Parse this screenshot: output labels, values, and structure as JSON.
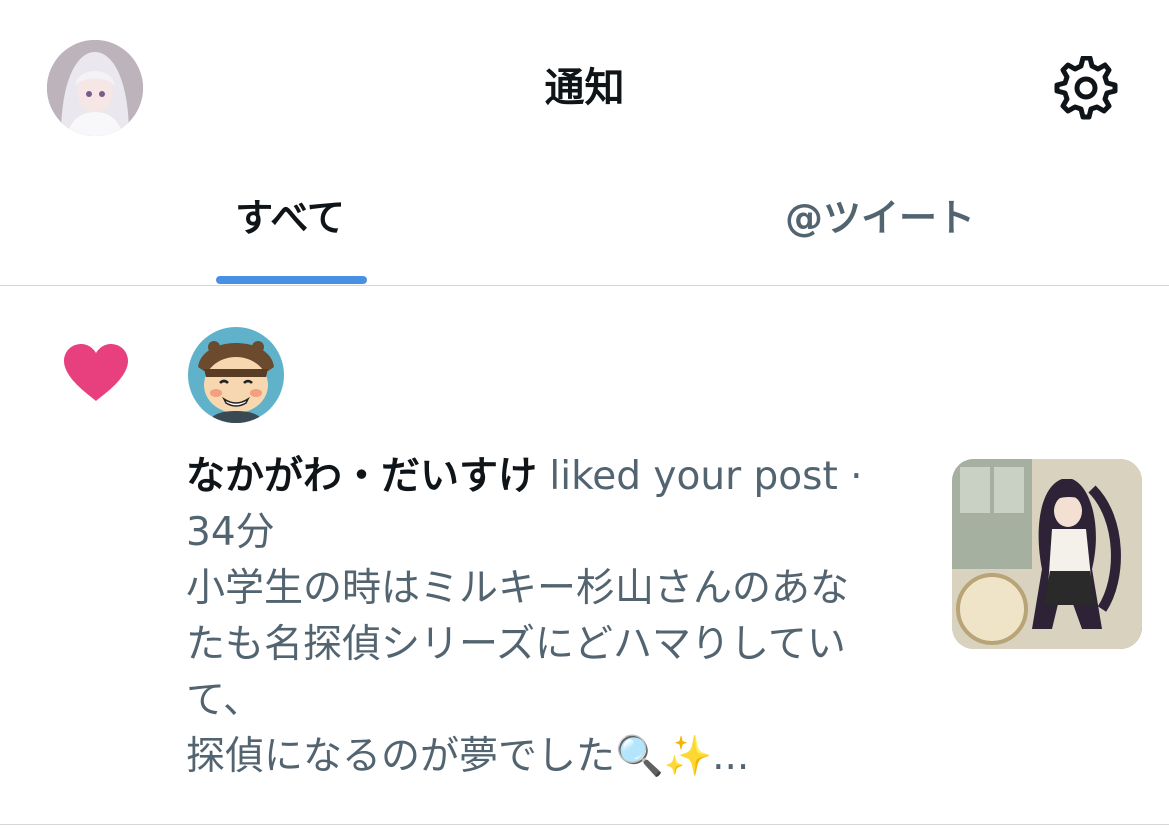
{
  "header": {
    "title": "通知",
    "profile_avatar_icon": "user-avatar",
    "settings_icon": "gear-icon"
  },
  "tabs": [
    {
      "label": "すべて",
      "active": true
    },
    {
      "label": "@ツイート",
      "active": false
    }
  ],
  "accent_color": "#4a90e2",
  "notification": {
    "type_icon": "heart-icon",
    "type_color": "#e8407f",
    "username": "なかがわ・だいすけ",
    "action": " liked your post",
    "separator": " · ",
    "time": "34分",
    "post_text_line1": "小学生の時はミルキー杉山さんのあな",
    "post_text_line2": "たも名探偵シリーズにどハマりしてい",
    "post_text_line3": "て、",
    "post_text_line4": "探偵になるのが夢でした🔍✨..."
  }
}
